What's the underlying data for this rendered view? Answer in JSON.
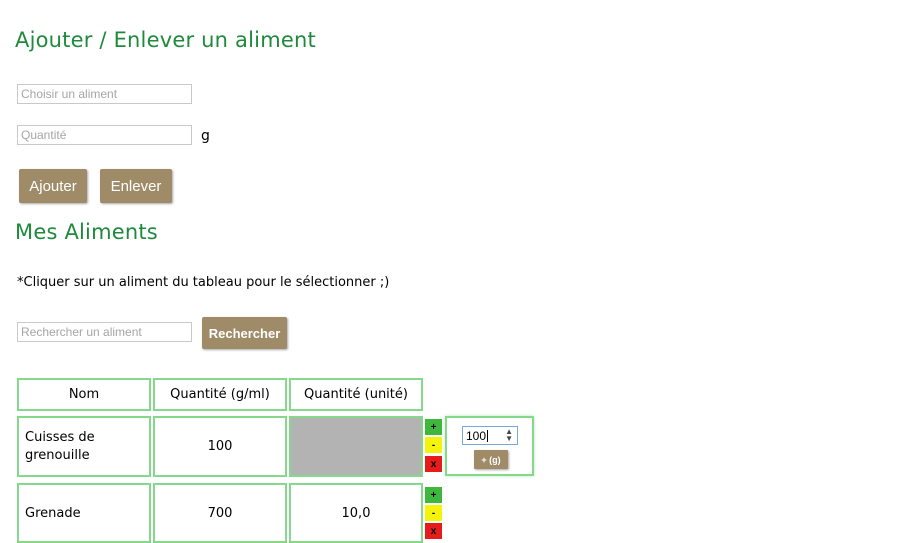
{
  "add_section": {
    "title": "Ajouter / Enlever un aliment",
    "food_placeholder": "Choisir un aliment",
    "qty_placeholder": "Quantité",
    "unit": "g",
    "add_label": "Ajouter",
    "remove_label": "Enlever"
  },
  "my_foods": {
    "title": "Mes Aliments",
    "hint": "*Cliquer sur un aliment du tableau pour le sélectionner ;)",
    "search_placeholder": "Rechercher un aliment",
    "search_label": "Rechercher"
  },
  "table": {
    "headers": [
      "Nom",
      "Quantité (g/ml)",
      "Quantité (unité)"
    ],
    "rows": [
      {
        "name": "Cuisses de grenouille",
        "qty_g": "100",
        "qty_unit": "",
        "unit_cell_disabled": true
      },
      {
        "name": "Grenade",
        "qty_g": "700",
        "qty_unit": "10,0",
        "unit_cell_disabled": false
      }
    ],
    "row_controls": {
      "plus": "+",
      "minus": "-",
      "delete": "x"
    }
  },
  "popup": {
    "value": "100",
    "add_label": "+ (g)"
  },
  "colors": {
    "heading": "#1f8a3c",
    "button": "#9f8b68",
    "table_border": "#86d98a",
    "disabled_cell": "#b3b3b3"
  }
}
